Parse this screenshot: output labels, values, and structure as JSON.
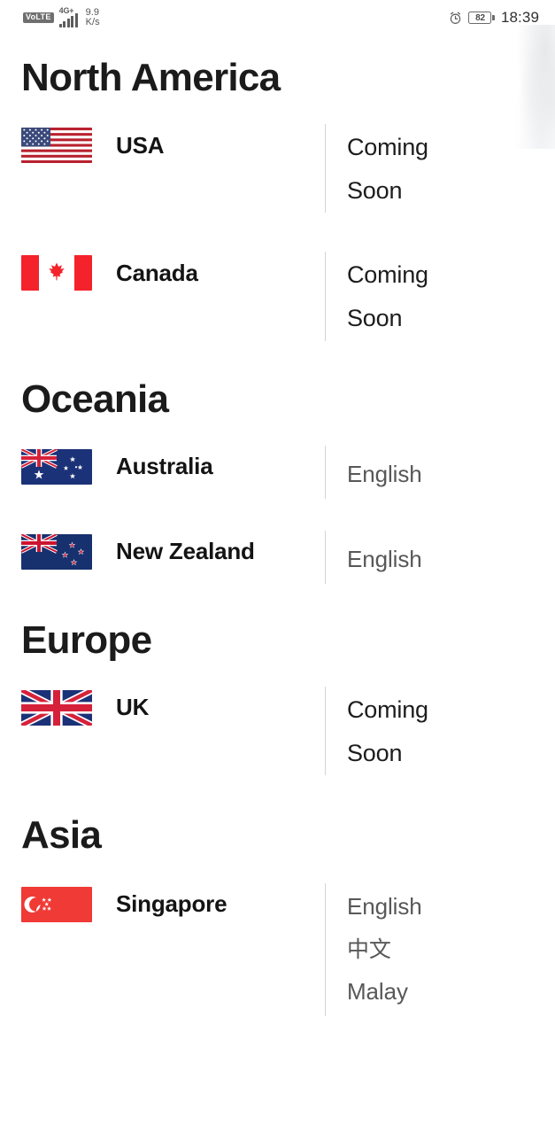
{
  "status_bar": {
    "volte_label": "VoLTE",
    "network_type": "4G+",
    "signal_icon": "signal-bars-icon",
    "speed_value": "9.9",
    "speed_unit": "K/s",
    "alarm_icon": "alarm-clock-icon",
    "battery_level": "82",
    "time": "18:39"
  },
  "regions": [
    {
      "title": "North America",
      "countries": [
        {
          "name": "USA",
          "flag_icon": "flag-usa-icon",
          "status": "Coming Soon",
          "status_type": "coming_soon",
          "languages": []
        },
        {
          "name": "Canada",
          "flag_icon": "flag-canada-icon",
          "status": "Coming Soon",
          "status_type": "coming_soon",
          "languages": []
        }
      ]
    },
    {
      "title": "Oceania",
      "countries": [
        {
          "name": "Australia",
          "flag_icon": "flag-australia-icon",
          "status": "",
          "status_type": "languages",
          "languages": [
            "English"
          ]
        },
        {
          "name": "New Zealand",
          "flag_icon": "flag-new-zealand-icon",
          "status": "",
          "status_type": "languages",
          "languages": [
            "English"
          ]
        }
      ]
    },
    {
      "title": "Europe",
      "countries": [
        {
          "name": "UK",
          "flag_icon": "flag-uk-icon",
          "status": "Coming Soon",
          "status_type": "coming_soon",
          "languages": []
        }
      ]
    },
    {
      "title": "Asia",
      "countries": [
        {
          "name": "Singapore",
          "flag_icon": "flag-singapore-icon",
          "status": "",
          "status_type": "languages",
          "languages": [
            "English",
            "中文",
            "Malay"
          ]
        }
      ]
    }
  ],
  "colors": {
    "heading": "#1b1b1b",
    "country_label": "#141414",
    "status_text": "#1d1d1d",
    "language_text": "#585858",
    "divider": "#d4d4d4",
    "background": "#ffffff"
  }
}
